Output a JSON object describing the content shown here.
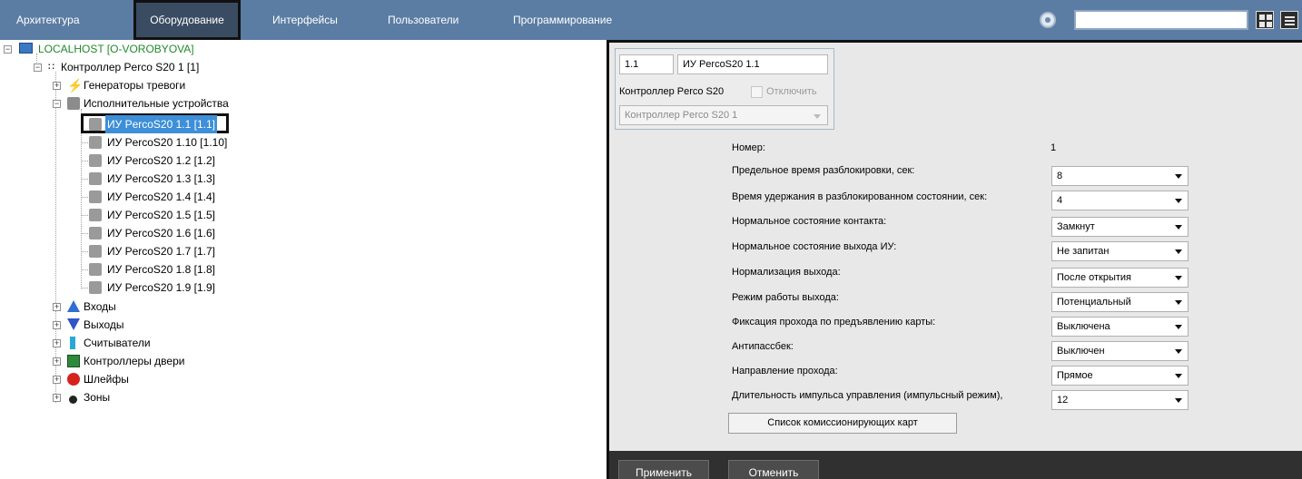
{
  "topbar": {
    "tabs": [
      {
        "label": "Архитектура"
      },
      {
        "label": "Оборудование"
      },
      {
        "label": "Интерфейсы"
      },
      {
        "label": "Пользователи"
      },
      {
        "label": "Программирование"
      }
    ],
    "search_value": ""
  },
  "tree": {
    "root": "LOCALHOST [O-VOROBYOVA]",
    "controller": "Контроллер Perco S20 1 [1]",
    "alarm_generators": "Генераторы тревоги",
    "actuators": "Исполнительные устройства",
    "devices": [
      "ИУ PercoS20 1.1 [1.1]",
      "ИУ PercoS20 1.10 [1.10]",
      "ИУ PercoS20 1.2 [1.2]",
      "ИУ PercoS20 1.3 [1.3]",
      "ИУ PercoS20 1.4 [1.4]",
      "ИУ PercoS20 1.5 [1.5]",
      "ИУ PercoS20 1.6 [1.6]",
      "ИУ PercoS20 1.7 [1.7]",
      "ИУ PercoS20 1.8 [1.8]",
      "ИУ PercoS20 1.9 [1.9]"
    ],
    "groups": [
      "Входы",
      "Выходы",
      "Считыватели",
      "Контроллеры двери",
      "Шлейфы",
      "Зоны"
    ]
  },
  "settings": {
    "id_value": "1.1",
    "name_value": "ИУ PercoS20 1.1",
    "parent_label": "Контроллер Perco S20",
    "disable_label": "Отключить",
    "parent_select": "Контроллер Perco S20 1",
    "number_label": "Номер:",
    "number_value": "1",
    "fields": [
      {
        "label": "Предельное время разблокировки, сек:",
        "value": "8"
      },
      {
        "label": "Время удержания в разблокированном состоянии, сек:",
        "value": "4"
      },
      {
        "label": "Нормальное состояние контакта:",
        "value": "Замкнут"
      },
      {
        "label": "Нормальное состояние выхода ИУ:",
        "value": "Не запитан"
      },
      {
        "label": "Нормализация выхода:",
        "value": "После открытия"
      },
      {
        "label": "Режим работы выхода:",
        "value": "Потенциальный"
      },
      {
        "label": "Фиксация прохода по предъявлению карты:",
        "value": "Выключена"
      },
      {
        "label": "Антипассбек:",
        "value": "Выключен"
      },
      {
        "label": "Направление прохода:",
        "value": "Прямое"
      },
      {
        "label": "Длительность импульса управления (импульсный режим),",
        "value": "12"
      }
    ],
    "commission_button": "Список комиссионирующих карт",
    "apply_button": "Применить",
    "cancel_button": "Отменить"
  }
}
